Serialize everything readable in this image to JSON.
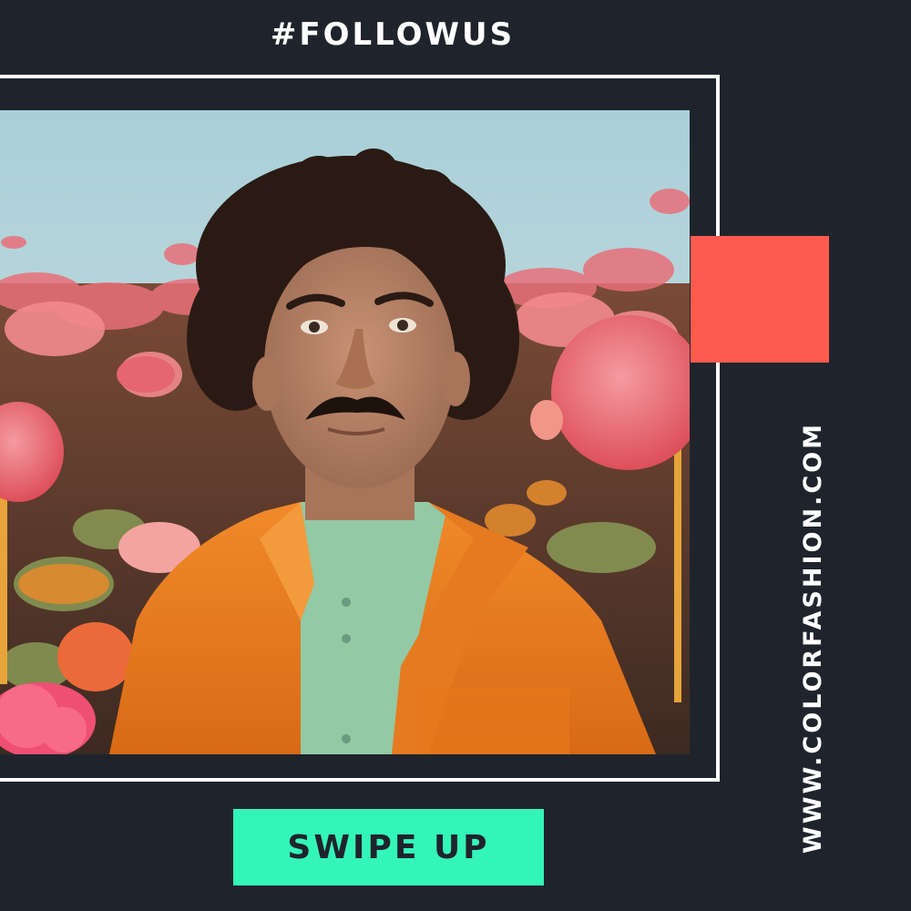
{
  "post": {
    "heading": "#FOLLOWUS",
    "cta_label": "SWIPE UP",
    "website": "WWW.COLORFASHION.COM"
  },
  "colors": {
    "background": "#1f242c",
    "frame": "#ffffff",
    "accent_block": "#ff5a4e",
    "cta_background": "#34f5b8",
    "cta_text": "#1f242c"
  },
  "photo": {
    "subject": "man-with-curly-hair-orange-jacket-in-pink-flower-field"
  }
}
